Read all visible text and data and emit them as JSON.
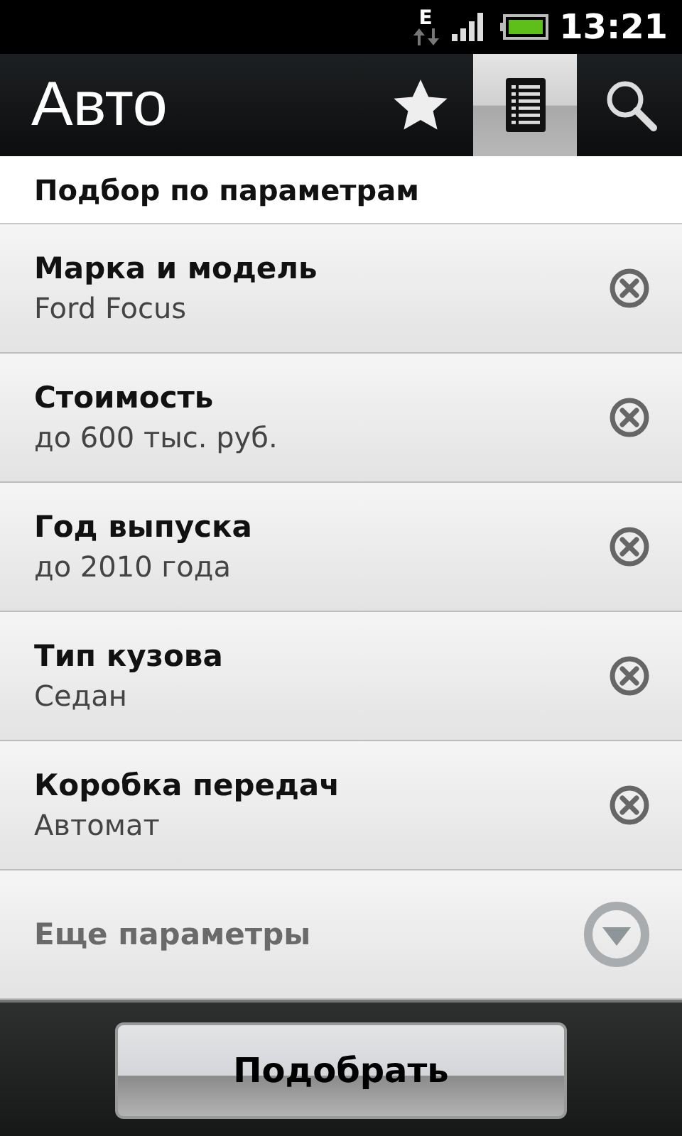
{
  "status_bar": {
    "network": "E",
    "time": "13:21"
  },
  "action_bar": {
    "title": "Авто",
    "tabs": [
      {
        "kind": "star",
        "selected": false
      },
      {
        "kind": "list",
        "selected": true
      },
      {
        "kind": "search",
        "selected": false
      }
    ]
  },
  "section_header": "Подбор по параметрам",
  "filters": [
    {
      "label": "Марка и модель",
      "value": "Ford Focus"
    },
    {
      "label": "Стоимость",
      "value": "до 600 тыс. руб."
    },
    {
      "label": "Год выпуска",
      "value": "до 2010 года"
    },
    {
      "label": "Тип кузова",
      "value": "Седан"
    },
    {
      "label": "Коробка передач",
      "value": "Автомат"
    }
  ],
  "more_row": {
    "label": "Еще параметры",
    "expanded": false
  },
  "submit_button": "Подобрать"
}
